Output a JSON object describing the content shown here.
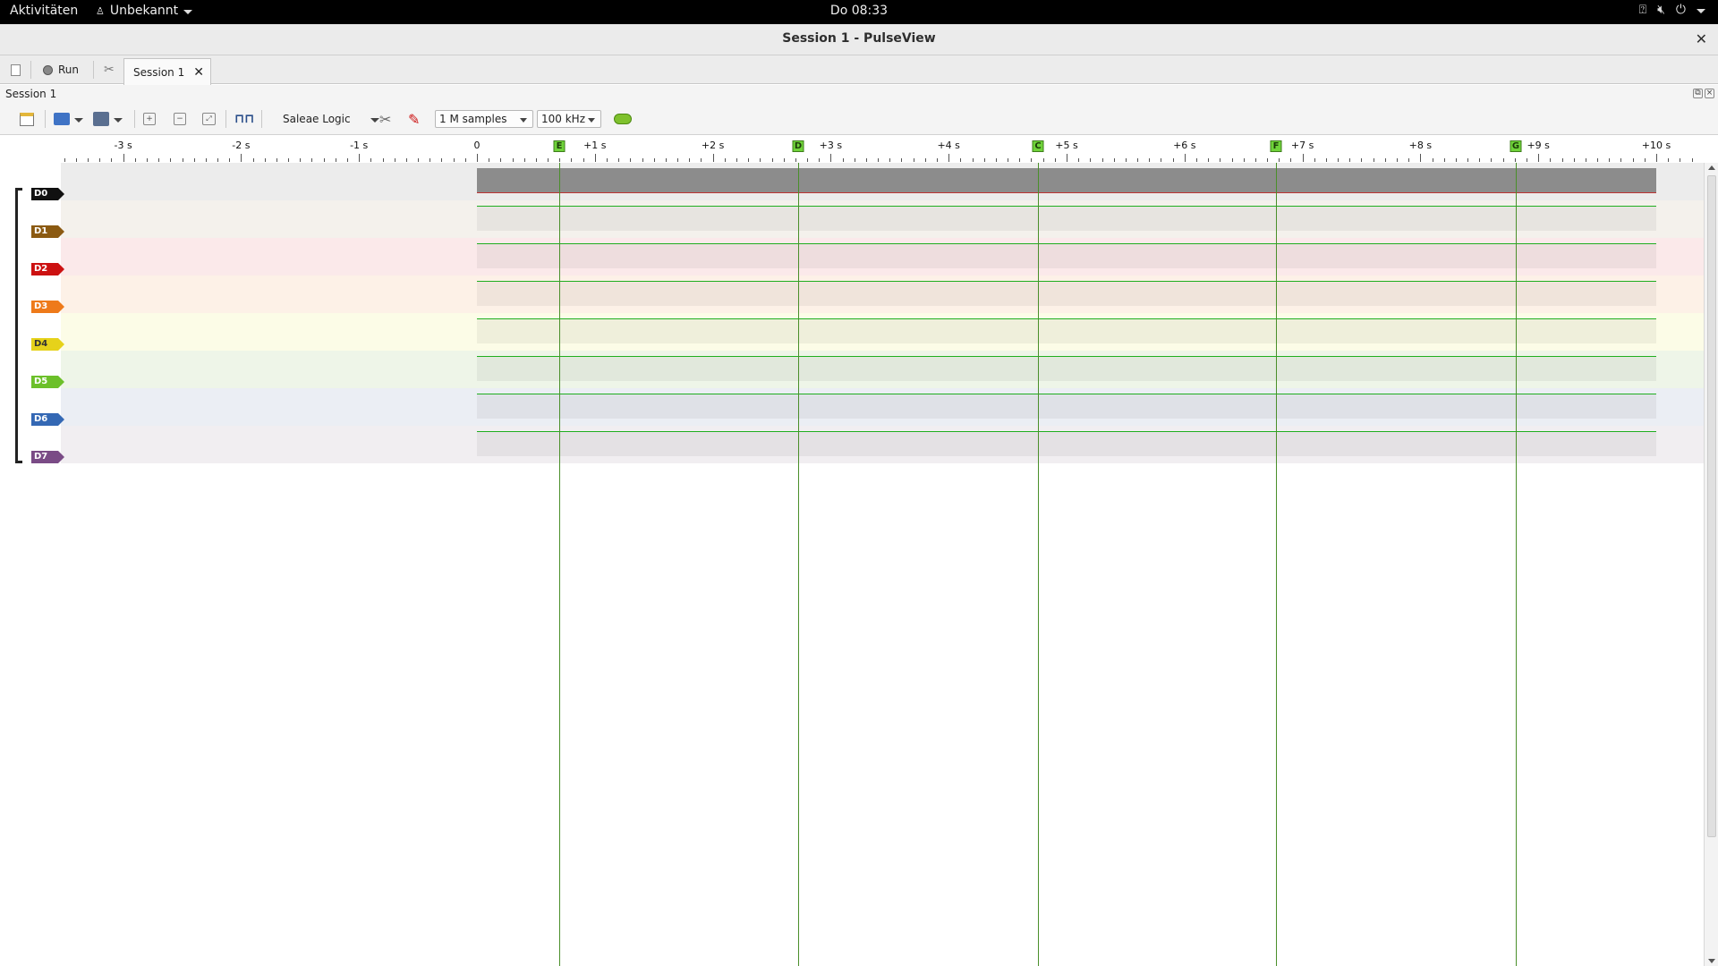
{
  "topbar": {
    "activities": "Aktivitäten",
    "app_menu": "Unbekannt",
    "clock": "Do 08:33"
  },
  "window": {
    "title": "Session 1 - PulseView"
  },
  "tabbar": {
    "run_label": "Run",
    "session_tab_label": "Session 1"
  },
  "session_header": {
    "label": "Session 1"
  },
  "toolbar": {
    "device": "Saleae Logic",
    "samples": "1 M samples",
    "samplerate": "100 kHz"
  },
  "ruler": {
    "ticks": [
      "-3 s",
      "-2 s",
      "-1 s",
      "0",
      "+1 s",
      "+2 s",
      "+3 s",
      "+4 s",
      "+5 s",
      "+6 s",
      "+7 s",
      "+8 s",
      "+9 s",
      "+10 s"
    ],
    "markers": [
      "E",
      "D",
      "C",
      "F",
      "G"
    ]
  },
  "channels": [
    {
      "name": "D0",
      "color": "#101010",
      "bg": "#ececec"
    },
    {
      "name": "D1",
      "color": "#8b5a12",
      "bg": "#f4f1ec"
    },
    {
      "name": "D2",
      "color": "#cc1111",
      "bg": "#fbe9ea"
    },
    {
      "name": "D3",
      "color": "#ee7a1a",
      "bg": "#fdf1e7"
    },
    {
      "name": "D4",
      "color": "#e6d21a",
      "bg": "#fcfce7"
    },
    {
      "name": "D5",
      "color": "#6cc02a",
      "bg": "#eef5e8"
    },
    {
      "name": "D6",
      "color": "#3468b4",
      "bg": "#ebeef4"
    },
    {
      "name": "D7",
      "color": "#7a4b86",
      "bg": "#f1eef1"
    }
  ],
  "colors": {
    "trace_line": "#1fae1f",
    "marker_line": "#4a8f2a",
    "d0_fill": "#8c8c8c"
  }
}
